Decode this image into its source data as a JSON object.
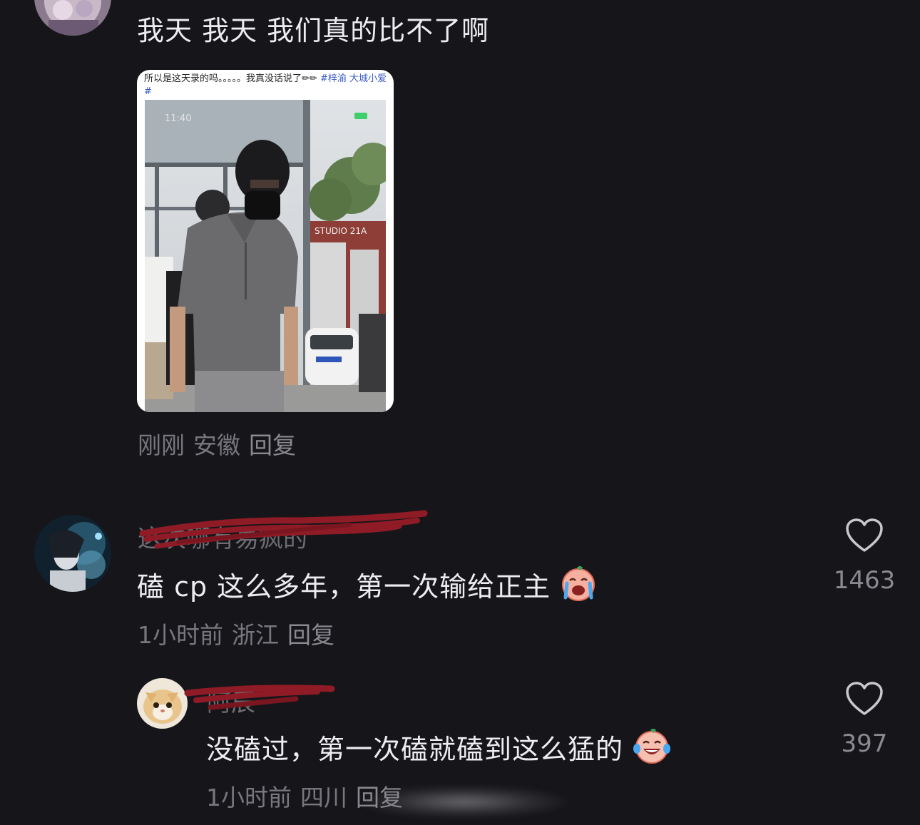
{
  "comments": [
    {
      "text": "我天  我天  我们真的比不了啊",
      "card": {
        "caption": "所以是这天录的吗。。。。。我真没话说了",
        "tags": "#梓渝 大城小爱#",
        "overlay_sign": "STUDIO 21A",
        "overlay_time": "11:40"
      },
      "meta": {
        "time": "刚刚",
        "location": "安徽",
        "reply": "回复"
      }
    },
    {
      "username": "这次哪有易疯的",
      "text": "磕 cp 这么多年，第一次输给正主",
      "meta": {
        "time": "1小时前",
        "location": "浙江",
        "reply": "回复"
      },
      "likes": "1463"
    },
    {
      "username": "阿辰",
      "text": "没磕过，第一次磕就磕到这么猛的",
      "meta": {
        "time": "1小时前",
        "location": "四川",
        "reply": "回复"
      },
      "likes": "397"
    }
  ],
  "icons": {
    "like": "heart-outline-icon",
    "emoji_cry": "loudly-crying-face-icon",
    "emoji_laugh": "tears-of-joy-face-icon"
  },
  "colors": {
    "background": "#16161a",
    "primary_text": "#ededf0",
    "meta_text": "#77777d",
    "scribble": "#8e1b25",
    "hashtag": "#3b5bc4"
  }
}
